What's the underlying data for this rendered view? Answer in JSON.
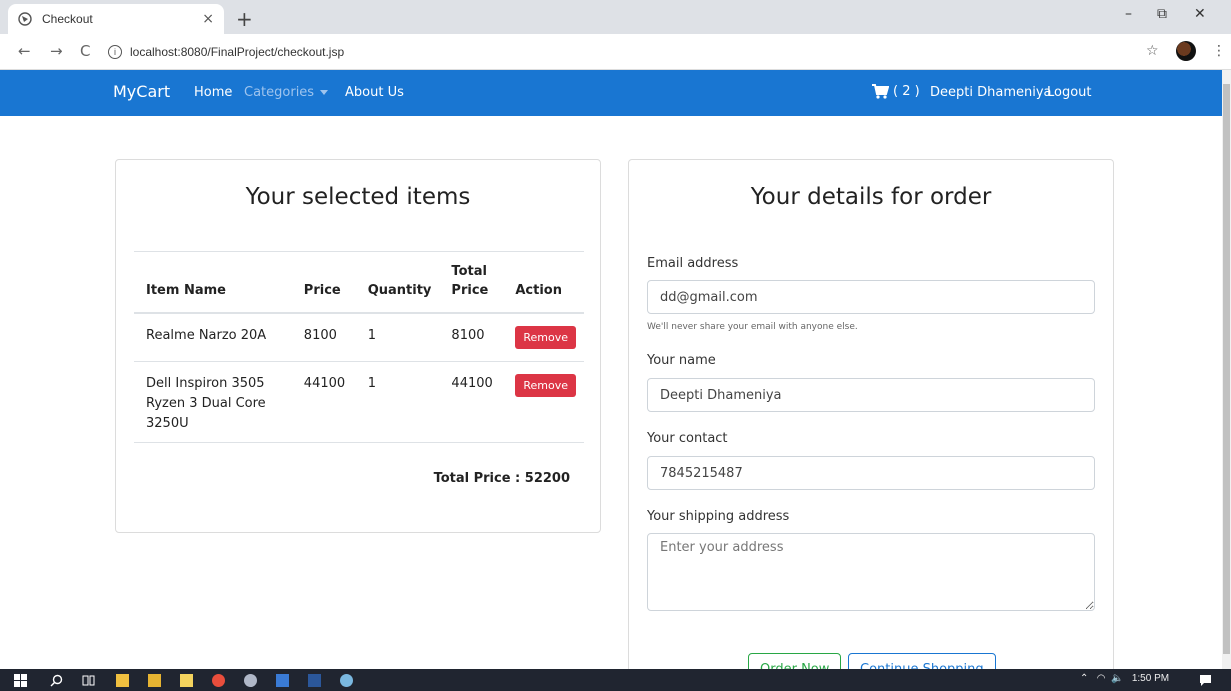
{
  "browser": {
    "tab_title": "Checkout",
    "tab_close": "×",
    "new_tab": "+",
    "url": "localhost:8080/FinalProject/checkout.jsp",
    "controls": {
      "minimize": "–",
      "restore": "⧉",
      "close": "✕"
    }
  },
  "navbar": {
    "brand": "MyCart",
    "links": {
      "home": "Home",
      "categories": "Categories",
      "about": "About Us"
    },
    "cart_count": "( 2 )",
    "user": "Deepti Dhameniya",
    "logout": "Logout",
    "color": "#1976d2"
  },
  "items_card": {
    "title": "Your selected items",
    "headers": {
      "name": "Item Name",
      "price": "Price",
      "quantity": "Quantity",
      "total_line1": "Total",
      "total_line2": "Price",
      "action": "Action"
    },
    "rows": [
      {
        "name": "Realme Narzo 20A",
        "price": "8100",
        "quantity": "1",
        "total": "8100",
        "action": "Remove"
      },
      {
        "name": "Dell Inspiron 3505 Ryzen 3 Dual Core 3250U",
        "price": "44100",
        "quantity": "1",
        "total": "44100",
        "action": "Remove"
      }
    ],
    "total_price": "Total Price : 52200"
  },
  "details_card": {
    "title": "Your details for order",
    "email": {
      "label": "Email address",
      "value": "dd@gmail.com",
      "help": "We'll never share your email with anyone else."
    },
    "name": {
      "label": "Your name",
      "value": "Deepti Dhameniya"
    },
    "contact": {
      "label": "Your contact",
      "value": "7845215487"
    },
    "address": {
      "label": "Your shipping address",
      "placeholder": "Enter your address"
    },
    "order_button": "Order Now",
    "continue_button": "Continue Shopping"
  },
  "taskbar": {
    "time": "1:50 PM"
  }
}
